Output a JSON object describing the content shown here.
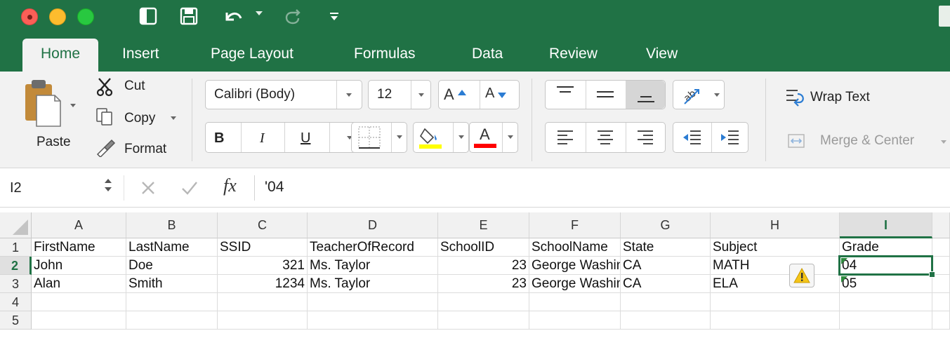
{
  "window": {
    "quick_access_icons": [
      "sidebar-toggle-icon",
      "save-icon",
      "undo-icon",
      "redo-icon",
      "customize-toolbar-icon"
    ]
  },
  "ribbon_tabs": [
    {
      "label": "Home",
      "active": true
    },
    {
      "label": "Insert",
      "active": false
    },
    {
      "label": "Page Layout",
      "active": false
    },
    {
      "label": "Formulas",
      "active": false
    },
    {
      "label": "Data",
      "active": false
    },
    {
      "label": "Review",
      "active": false
    },
    {
      "label": "View",
      "active": false
    }
  ],
  "clipboard": {
    "paste_label": "Paste",
    "cut_label": "Cut",
    "copy_label": "Copy",
    "format_label": "Format"
  },
  "font": {
    "family": "Calibri (Body)",
    "size": "12",
    "grow_label": "A",
    "shrink_label": "A",
    "bold_label": "B",
    "italic_label": "I",
    "underline_label": "U",
    "font_color_label": "A",
    "highlight_color": "#ffff00",
    "font_color": "#ff0000"
  },
  "alignment": {
    "wrap_text_label": "Wrap Text",
    "merge_center_label": "Merge & Center"
  },
  "formula_bar": {
    "name_box": "I2",
    "formula": "'04",
    "fx_label": "fx"
  },
  "sheet": {
    "columns": [
      "A",
      "B",
      "C",
      "D",
      "E",
      "F",
      "G",
      "H",
      "I"
    ],
    "selected_column": "I",
    "row_numbers": [
      "1",
      "2",
      "3",
      "4",
      "5"
    ],
    "selected_row": "2",
    "rows": [
      [
        "FirstName",
        "LastName",
        "SSID",
        "TeacherOfRecord",
        "SchoolID",
        "SchoolName",
        "State",
        "Subject",
        "Grade"
      ],
      [
        "John",
        "Doe",
        "321",
        "Ms. Taylor",
        "23",
        "George Washington",
        "CA",
        "MATH",
        "04"
      ],
      [
        "Alan",
        "Smith",
        "1234",
        "Ms. Taylor",
        "23",
        "George Washington",
        "CA",
        "ELA",
        "05"
      ],
      [
        "",
        "",
        "",
        "",
        "",
        "",
        "",
        "",
        ""
      ],
      [
        "",
        "",
        "",
        "",
        "",
        "",
        "",
        "",
        ""
      ]
    ],
    "active_cell": "I2"
  },
  "colors": {
    "accent": "#207245",
    "ribbon_bg": "#f2f2f2"
  }
}
